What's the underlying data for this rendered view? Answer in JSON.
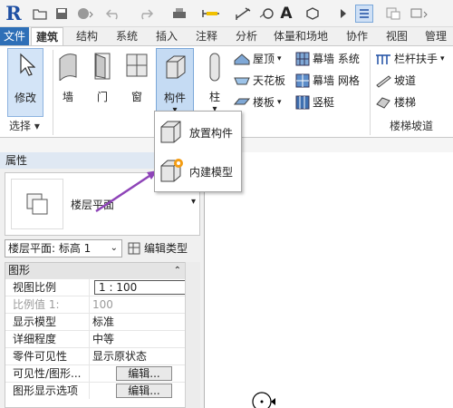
{
  "app": {
    "logo": "R"
  },
  "quick_access": {
    "icons": [
      "open-icon",
      "save-icon",
      "sync-icon",
      "undo-icon",
      "redo-icon",
      "print-icon",
      "measure-icon",
      "dimension-icon",
      "tag-icon",
      "text-icon",
      "3d-view-icon",
      "section-icon",
      "thin-lines-icon",
      "close-hidden-icon",
      "switch-windows-icon"
    ]
  },
  "tabs": [
    "文件",
    "建筑",
    "结构",
    "系统",
    "插入",
    "注释",
    "分析",
    "体量和场地",
    "协作",
    "视图",
    "管理"
  ],
  "ribbon": {
    "modify": "修改",
    "select_panel": "选择",
    "wall": "墙",
    "door": "门",
    "window": "窗",
    "component": "构件",
    "column": "柱",
    "roof": "屋顶",
    "ceiling": "天花板",
    "floor": "楼板",
    "curtain_system": "幕墙 系统",
    "curtain_grid": "幕墙 网格",
    "mullion": "竖梃",
    "railing": "栏杆扶手",
    "ramp": "坡道",
    "stair": "楼梯",
    "stair_panel": "楼梯坡道"
  },
  "component_menu": {
    "place_component": "放置构件",
    "model_in_place": "内建模型"
  },
  "properties": {
    "title": "属性",
    "type_name": "楼层平面",
    "instance_selector": "楼层平面: 标高 1",
    "edit_type": "编辑类型",
    "group": "图形",
    "rows": [
      {
        "key": "视图比例",
        "value": "1 : 100"
      },
      {
        "key": "比例值 1:",
        "value": "100"
      },
      {
        "key": "显示模型",
        "value": "标准"
      },
      {
        "key": "详细程度",
        "value": "中等"
      },
      {
        "key": "零件可见性",
        "value": "显示原状态"
      },
      {
        "key": "可见性/图形...",
        "value": "编辑..."
      },
      {
        "key": "图形显示选项",
        "value": "编辑..."
      }
    ]
  },
  "colors": {
    "file_tab": "#2e6fb7",
    "accent_arrow": "#8e44b8",
    "selected": "#d3e4f7"
  }
}
